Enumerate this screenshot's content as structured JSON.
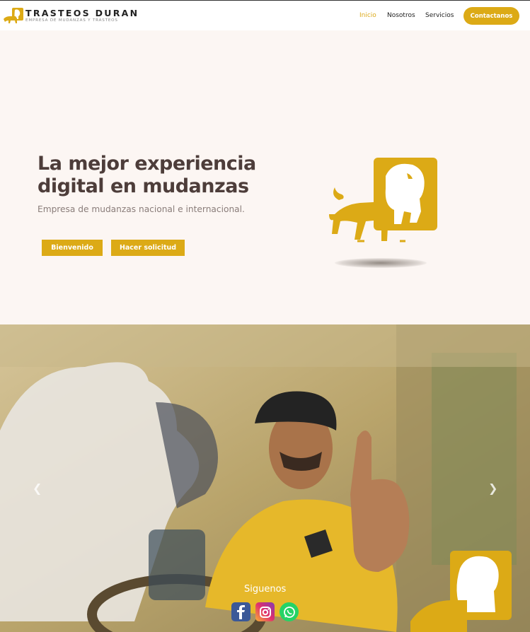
{
  "brand": {
    "name": "TRASTEOS DURAN",
    "tagline": "EMPRESA DE MUDANZAS Y TRASTEOS"
  },
  "nav": {
    "items": [
      {
        "label": "Inicio",
        "active": true
      },
      {
        "label": "Nosotros",
        "active": false
      },
      {
        "label": "Servicios",
        "active": false
      }
    ],
    "cta": "Contactanos"
  },
  "hero": {
    "title": "La mejor experiencia digital en mudanzas",
    "subtitle": "Empresa de mudanzas nacional e internacional.",
    "buttons": [
      "Bienvenido",
      "Hacer solicitud"
    ]
  },
  "social": {
    "heading": "Siguenos",
    "icons": [
      "facebook-icon",
      "instagram-icon",
      "whatsapp-icon"
    ]
  },
  "colors": {
    "accent": "#dcaa16",
    "hero_bg": "#fcf6f3",
    "title": "#4d3d3a"
  }
}
